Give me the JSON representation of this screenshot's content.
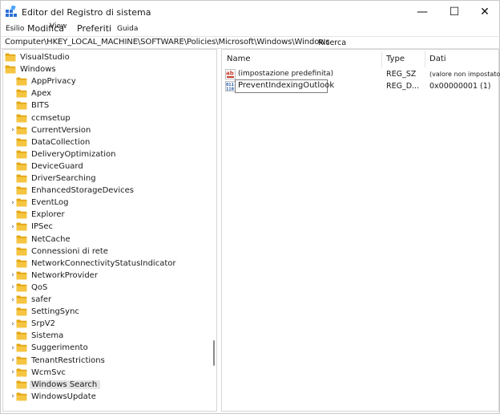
{
  "window": {
    "title": "Editor del Registro di sistema",
    "buttons": {
      "minimize": "—",
      "maximize": "☐",
      "close": "✕"
    }
  },
  "menu": [
    "Esilio",
    "Modifica",
    "View",
    "Preferiti",
    "Guida"
  ],
  "address": {
    "path": "Computer\\HKEY_LOCAL_MACHINE\\SOFTWARE\\Policies\\Microsoft\\Windows\\Windows",
    "tail": "Ricerca"
  },
  "tree": {
    "items": [
      {
        "label": "VisualStudio",
        "level": 0,
        "expandable": false
      },
      {
        "label": "Windows",
        "level": 0,
        "expandable": false
      },
      {
        "label": "AppPrivacy",
        "level": 1,
        "expandable": false
      },
      {
        "label": "Apex",
        "level": 1,
        "expandable": false
      },
      {
        "label": "BITS",
        "level": 1,
        "expandable": false
      },
      {
        "label": "ccmsetup",
        "level": 1,
        "expandable": false
      },
      {
        "label": "CurrentVersion",
        "level": 1,
        "expandable": true
      },
      {
        "label": "DataCollection",
        "level": 1,
        "expandable": false
      },
      {
        "label": "DeliveryOptimization",
        "level": 1,
        "expandable": false
      },
      {
        "label": "DeviceGuard",
        "level": 1,
        "expandable": false
      },
      {
        "label": "DriverSearching",
        "level": 1,
        "expandable": false
      },
      {
        "label": "EnhancedStorageDevices",
        "level": 1,
        "expandable": false
      },
      {
        "label": "EventLog",
        "level": 1,
        "expandable": true
      },
      {
        "label": "Explorer",
        "level": 1,
        "expandable": false
      },
      {
        "label": "IPSec",
        "level": 1,
        "expandable": true
      },
      {
        "label": "NetCache",
        "level": 1,
        "expandable": false
      },
      {
        "label": "Connessioni di rete",
        "level": 1,
        "expandable": false
      },
      {
        "label": "NetworkConnectivityStatusIndicator",
        "level": 1,
        "expandable": false
      },
      {
        "label": "NetworkProvider",
        "level": 1,
        "expandable": true
      },
      {
        "label": "QoS",
        "level": 1,
        "expandable": true
      },
      {
        "label": "safer",
        "level": 1,
        "expandable": true
      },
      {
        "label": "SettingSync",
        "level": 1,
        "expandable": false
      },
      {
        "label": "SrpV2",
        "level": 1,
        "expandable": true
      },
      {
        "label": "Sistema",
        "level": 1,
        "expandable": false
      },
      {
        "label": "Suggerimento",
        "level": 1,
        "expandable": true
      },
      {
        "label": "TenantRestrictions",
        "level": 1,
        "expandable": true
      },
      {
        "label": "WcmSvc",
        "level": 1,
        "expandable": true
      },
      {
        "label": "Windows Search",
        "level": 1,
        "expandable": false,
        "selected": true
      },
      {
        "label": "WindowsUpdate",
        "level": 1,
        "expandable": true
      }
    ]
  },
  "values": {
    "columns": {
      "name": "Name",
      "type": "Type",
      "data": "Dati"
    },
    "rows": [
      {
        "icon": "string-value-icon",
        "name": "(impostazione predefinita)",
        "type": "REG_SZ",
        "data": "(valore non impostato)"
      },
      {
        "icon": "dword-value-icon",
        "name": "PreventIndexingOutlook",
        "type": "REG_D...",
        "data": "0x00000001 (1)",
        "editing": true
      }
    ]
  },
  "colors": {
    "folder": "#f5c542",
    "folder_dark": "#e3a816",
    "selection": "#e5e5e5",
    "accent": "#0067c0"
  }
}
